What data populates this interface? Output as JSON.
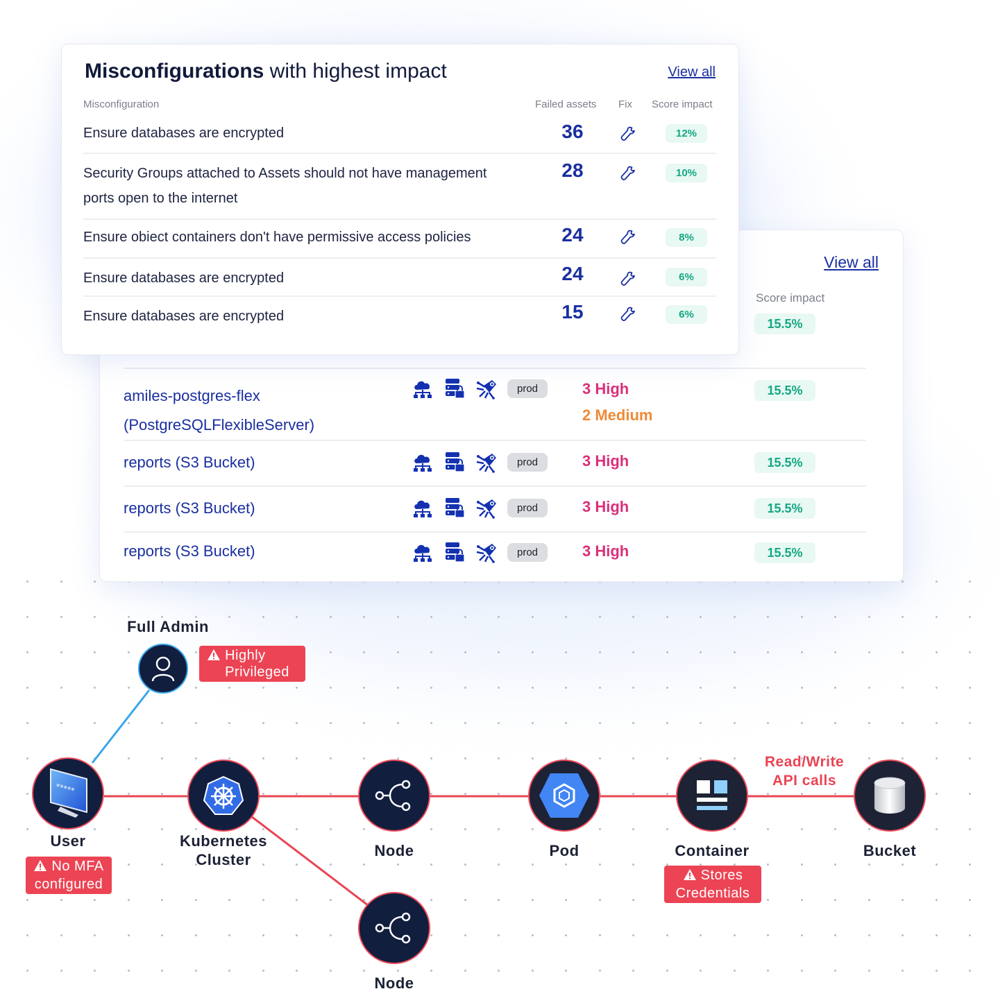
{
  "misconfig_card": {
    "title_bold": "Misconfigurations",
    "title_rest": " with highest impact",
    "view_all": "View all",
    "columns": {
      "misconfiguration": "Misconfiguration",
      "failed_assets": "Failed assets",
      "fix": "Fix",
      "score_impact": "Score impact"
    },
    "rows": [
      {
        "name": "Ensure databases are encrypted",
        "failed_assets": "36",
        "fix_icon": "wrench-icon",
        "score_impact": "12%"
      },
      {
        "name": "Security Groups attached to Assets should not have management ports open to the internet",
        "failed_assets": "28",
        "fix_icon": "wrench-icon",
        "score_impact": "10%"
      },
      {
        "name": "Ensure obiect containers don't have permissive access policies",
        "failed_assets": "24",
        "fix_icon": "wrench-icon",
        "score_impact": "8%"
      },
      {
        "name": "Ensure databases are encrypted",
        "failed_assets": "24",
        "fix_icon": "wrench-icon",
        "score_impact": "6%"
      },
      {
        "name": "Ensure databases are encrypted",
        "failed_assets": "15",
        "fix_icon": "wrench-icon",
        "score_impact": "6%"
      }
    ]
  },
  "assets_card": {
    "view_all": "View all",
    "score_impact_header": "Score impact",
    "header_score": "15.5%",
    "rows": [
      {
        "name": "amiles-postgres-flex (PostgreSQLFlexibleServer)",
        "tag": "prod",
        "severity_high": "3 High",
        "severity_medium": "2 Medium",
        "score_impact": "15.5%"
      },
      {
        "name": "reports (S3 Bucket)",
        "tag": "prod",
        "severity_high": "3 High",
        "severity_medium": null,
        "score_impact": "15.5%"
      },
      {
        "name": "reports (S3 Bucket)",
        "tag": "prod",
        "severity_high": "3 High",
        "severity_medium": null,
        "score_impact": "15.5%"
      },
      {
        "name": "reports (S3 Bucket)",
        "tag": "prod",
        "severity_high": "3 High",
        "severity_medium": null,
        "score_impact": "15.5%"
      }
    ],
    "row_icons": [
      "cloud-network-icon",
      "server-lock-icon",
      "bug-icon"
    ]
  },
  "attack_path": {
    "nodes": {
      "admin": {
        "label": "Full Admin",
        "alert": "Highly Privileged",
        "icon": "person-icon"
      },
      "user": {
        "label": "User",
        "alert": "No MFA configured",
        "icon": "password-monitor-icon"
      },
      "cluster": {
        "label": "Kubernetes Cluster",
        "icon": "kubernetes-icon"
      },
      "node1": {
        "label": "Node",
        "icon": "node-share-icon"
      },
      "node2": {
        "label": "Node",
        "icon": "node-share-icon"
      },
      "pod": {
        "label": "Pod",
        "icon": "pod-cube-icon"
      },
      "container": {
        "label": "Container",
        "alert": "Stores Credentials",
        "icon": "container-layout-icon"
      },
      "bucket": {
        "label": "Bucket",
        "icon": "bucket-cylinder-icon"
      }
    },
    "edge_label": "Read/Write API calls",
    "colors": {
      "risk_edge": "#e94452",
      "privilege_edge": "#3aa6ea",
      "node_fill": "#111e3e",
      "alert": "#ec4454"
    }
  }
}
